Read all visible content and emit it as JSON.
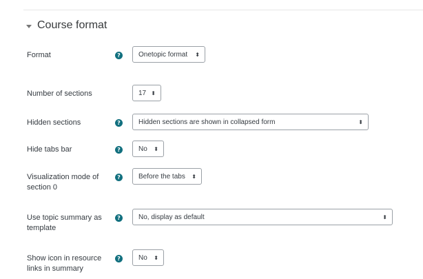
{
  "section": {
    "title": "Course format"
  },
  "fields": [
    {
      "key": "format",
      "label": "Format",
      "has_help": true,
      "value": "Onetopic format"
    },
    {
      "key": "numsections",
      "label": "Number of sections",
      "has_help": false,
      "value": "17"
    },
    {
      "key": "hiddensections",
      "label": "Hidden sections",
      "has_help": true,
      "value": "Hidden sections are shown in collapsed form"
    },
    {
      "key": "hidetabsbar",
      "label": "Hide tabs bar",
      "has_help": true,
      "value": "No"
    },
    {
      "key": "section0",
      "label": "Visualization mode of section 0",
      "has_help": true,
      "value": "Before the tabs"
    },
    {
      "key": "templatetopic",
      "label": "Use topic summary as template",
      "has_help": true,
      "value": "No, display as default"
    },
    {
      "key": "templatetopic_icons",
      "label": "Show icon in resource links in summary",
      "has_help": true,
      "value": "No"
    }
  ],
  "help_glyph": "?",
  "select_arrows": "⬍",
  "icons": {
    "help": "question-circle-icon",
    "collapse": "caret-down-icon",
    "select": "select-arrows-icon"
  },
  "colors": {
    "help_icon": "#12707f",
    "border": "#9aa0a6",
    "text": "#343a40"
  }
}
